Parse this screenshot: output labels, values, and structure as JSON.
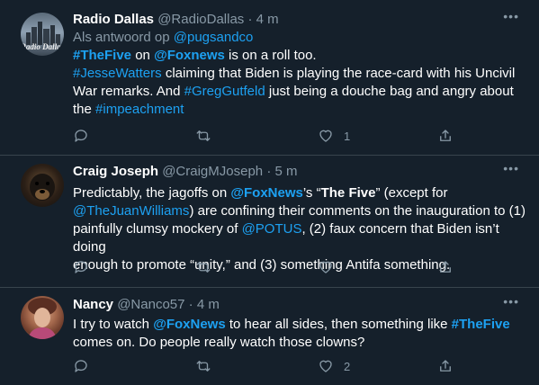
{
  "tweets": [
    {
      "name": "Radio Dallas",
      "handle": "@RadioDallas",
      "time": "4 m",
      "reply_prefix": "Als antwoord op",
      "reply_to": "@pugsandco",
      "line1": {
        "t1": "#TheFive",
        "t2": " on ",
        "t3": "@Foxnews",
        "t4": " is on a roll too."
      },
      "line2": {
        "t1": "#JesseWatters",
        "t2": " claiming that Biden is playing the race-card with his Uncivil"
      },
      "line3": {
        "t1": "War remarks. And ",
        "t2": "#GregGutfeld",
        "t3": " just being a douche bag and angry about"
      },
      "line4": {
        "t1": "the ",
        "t2": "#impeachment"
      },
      "like_count": "1",
      "avatar_text": "Radio Dallas"
    },
    {
      "name": "Craig Joseph",
      "handle": "@CraigMJoseph",
      "time": "5 m",
      "line1": {
        "t1": "Predictably, the jagoffs on ",
        "t2": "@FoxNews",
        "t3": "’s “",
        "t4": "The Five",
        "t5": "” (except for"
      },
      "line2": {
        "t1": "@TheJuanWilliams",
        "t2": ") are confining their comments on the inauguration to (1)"
      },
      "line3": {
        "t1": "painfully clumsy mockery of ",
        "t2": "@POTUS",
        "t3": ", (2) faux concern that Biden isn’t doing"
      },
      "line4": {
        "t1": "enough to promote “unity,” and (3) something Antifa something."
      }
    },
    {
      "name": "Nancy",
      "handle": "@Nanco57",
      "time": "4 m",
      "line1": {
        "t1": "I try to watch ",
        "t2": "@FoxNews",
        "t3": " to hear all sides, then something like ",
        "t4": "#TheFive"
      },
      "line2": {
        "t1": "comes on. Do people really watch those clowns?"
      },
      "like_count": "2"
    }
  ],
  "separator": "·",
  "more_glyph": "•••",
  "colors": {
    "background": "#15202b",
    "link": "#1da1f2",
    "muted": "#8899a6",
    "border": "#38444d"
  },
  "icons": [
    "reply-icon",
    "retweet-icon",
    "like-icon",
    "share-icon",
    "more-icon"
  ]
}
